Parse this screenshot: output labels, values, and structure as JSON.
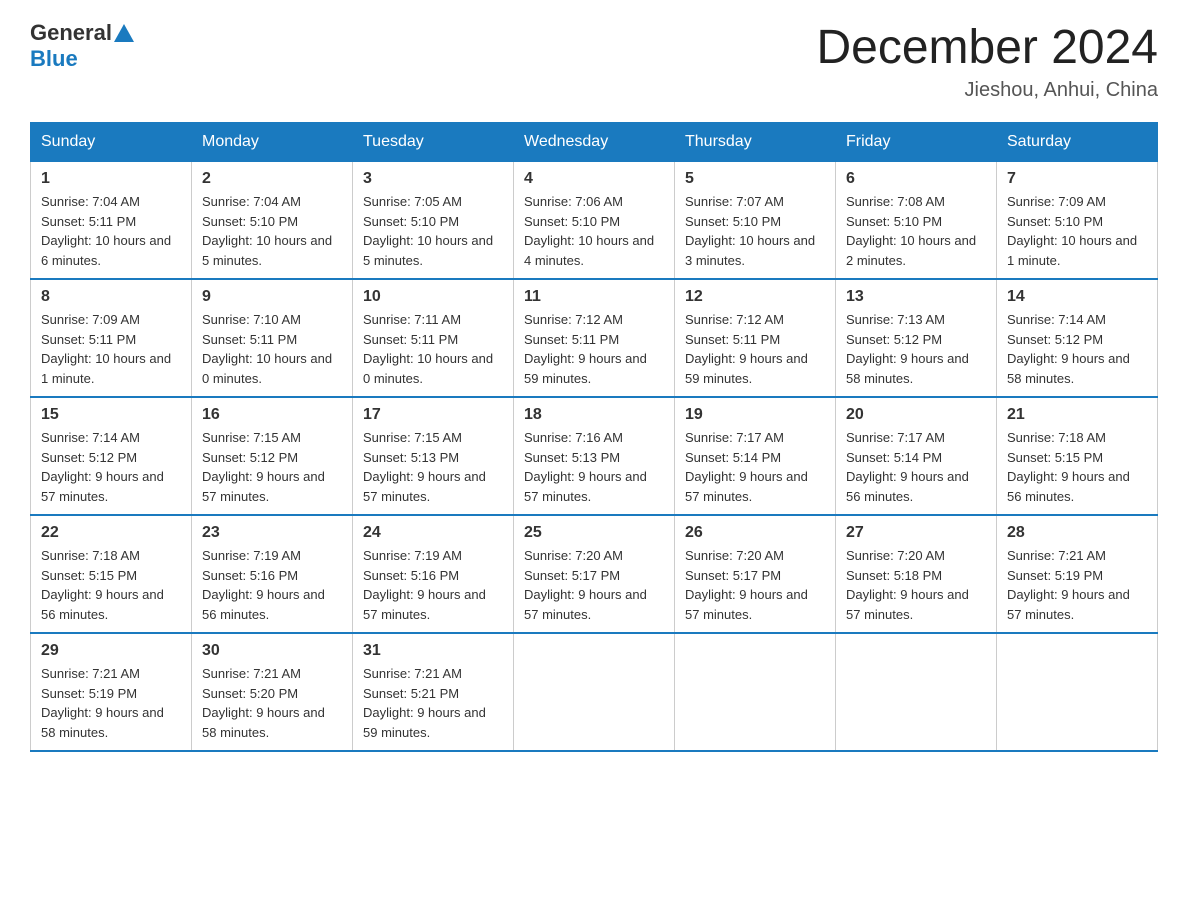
{
  "header": {
    "logo_general": "General",
    "logo_blue": "Blue",
    "month_title": "December 2024",
    "location": "Jieshou, Anhui, China"
  },
  "days_of_week": [
    "Sunday",
    "Monday",
    "Tuesday",
    "Wednesday",
    "Thursday",
    "Friday",
    "Saturday"
  ],
  "weeks": [
    [
      {
        "day": "1",
        "sunrise": "7:04 AM",
        "sunset": "5:11 PM",
        "daylight": "10 hours and 6 minutes."
      },
      {
        "day": "2",
        "sunrise": "7:04 AM",
        "sunset": "5:10 PM",
        "daylight": "10 hours and 5 minutes."
      },
      {
        "day": "3",
        "sunrise": "7:05 AM",
        "sunset": "5:10 PM",
        "daylight": "10 hours and 5 minutes."
      },
      {
        "day": "4",
        "sunrise": "7:06 AM",
        "sunset": "5:10 PM",
        "daylight": "10 hours and 4 minutes."
      },
      {
        "day": "5",
        "sunrise": "7:07 AM",
        "sunset": "5:10 PM",
        "daylight": "10 hours and 3 minutes."
      },
      {
        "day": "6",
        "sunrise": "7:08 AM",
        "sunset": "5:10 PM",
        "daylight": "10 hours and 2 minutes."
      },
      {
        "day": "7",
        "sunrise": "7:09 AM",
        "sunset": "5:10 PM",
        "daylight": "10 hours and 1 minute."
      }
    ],
    [
      {
        "day": "8",
        "sunrise": "7:09 AM",
        "sunset": "5:11 PM",
        "daylight": "10 hours and 1 minute."
      },
      {
        "day": "9",
        "sunrise": "7:10 AM",
        "sunset": "5:11 PM",
        "daylight": "10 hours and 0 minutes."
      },
      {
        "day": "10",
        "sunrise": "7:11 AM",
        "sunset": "5:11 PM",
        "daylight": "10 hours and 0 minutes."
      },
      {
        "day": "11",
        "sunrise": "7:12 AM",
        "sunset": "5:11 PM",
        "daylight": "9 hours and 59 minutes."
      },
      {
        "day": "12",
        "sunrise": "7:12 AM",
        "sunset": "5:11 PM",
        "daylight": "9 hours and 59 minutes."
      },
      {
        "day": "13",
        "sunrise": "7:13 AM",
        "sunset": "5:12 PM",
        "daylight": "9 hours and 58 minutes."
      },
      {
        "day": "14",
        "sunrise": "7:14 AM",
        "sunset": "5:12 PM",
        "daylight": "9 hours and 58 minutes."
      }
    ],
    [
      {
        "day": "15",
        "sunrise": "7:14 AM",
        "sunset": "5:12 PM",
        "daylight": "9 hours and 57 minutes."
      },
      {
        "day": "16",
        "sunrise": "7:15 AM",
        "sunset": "5:12 PM",
        "daylight": "9 hours and 57 minutes."
      },
      {
        "day": "17",
        "sunrise": "7:15 AM",
        "sunset": "5:13 PM",
        "daylight": "9 hours and 57 minutes."
      },
      {
        "day": "18",
        "sunrise": "7:16 AM",
        "sunset": "5:13 PM",
        "daylight": "9 hours and 57 minutes."
      },
      {
        "day": "19",
        "sunrise": "7:17 AM",
        "sunset": "5:14 PM",
        "daylight": "9 hours and 57 minutes."
      },
      {
        "day": "20",
        "sunrise": "7:17 AM",
        "sunset": "5:14 PM",
        "daylight": "9 hours and 56 minutes."
      },
      {
        "day": "21",
        "sunrise": "7:18 AM",
        "sunset": "5:15 PM",
        "daylight": "9 hours and 56 minutes."
      }
    ],
    [
      {
        "day": "22",
        "sunrise": "7:18 AM",
        "sunset": "5:15 PM",
        "daylight": "9 hours and 56 minutes."
      },
      {
        "day": "23",
        "sunrise": "7:19 AM",
        "sunset": "5:16 PM",
        "daylight": "9 hours and 56 minutes."
      },
      {
        "day": "24",
        "sunrise": "7:19 AM",
        "sunset": "5:16 PM",
        "daylight": "9 hours and 57 minutes."
      },
      {
        "day": "25",
        "sunrise": "7:20 AM",
        "sunset": "5:17 PM",
        "daylight": "9 hours and 57 minutes."
      },
      {
        "day": "26",
        "sunrise": "7:20 AM",
        "sunset": "5:17 PM",
        "daylight": "9 hours and 57 minutes."
      },
      {
        "day": "27",
        "sunrise": "7:20 AM",
        "sunset": "5:18 PM",
        "daylight": "9 hours and 57 minutes."
      },
      {
        "day": "28",
        "sunrise": "7:21 AM",
        "sunset": "5:19 PM",
        "daylight": "9 hours and 57 minutes."
      }
    ],
    [
      {
        "day": "29",
        "sunrise": "7:21 AM",
        "sunset": "5:19 PM",
        "daylight": "9 hours and 58 minutes."
      },
      {
        "day": "30",
        "sunrise": "7:21 AM",
        "sunset": "5:20 PM",
        "daylight": "9 hours and 58 minutes."
      },
      {
        "day": "31",
        "sunrise": "7:21 AM",
        "sunset": "5:21 PM",
        "daylight": "9 hours and 59 minutes."
      },
      null,
      null,
      null,
      null
    ]
  ]
}
